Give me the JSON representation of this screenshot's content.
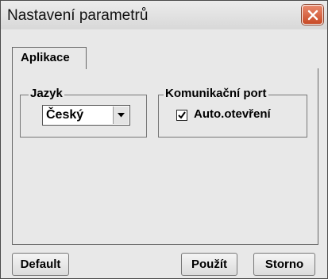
{
  "window": {
    "title": "Nastavení parametrů"
  },
  "tabs": [
    {
      "label": "Aplikace",
      "active": true
    }
  ],
  "language_group": {
    "legend": "Jazyk",
    "selected": "Český"
  },
  "port_group": {
    "legend": "Komunikační port",
    "auto_open_label": "Auto.otevření",
    "auto_open_checked": true
  },
  "buttons": {
    "default_label": "Default",
    "apply_label": "Použít",
    "cancel_label": "Storno"
  },
  "colors": {
    "close_button": "#d0532e",
    "panel_background": "#e8e8e8"
  }
}
